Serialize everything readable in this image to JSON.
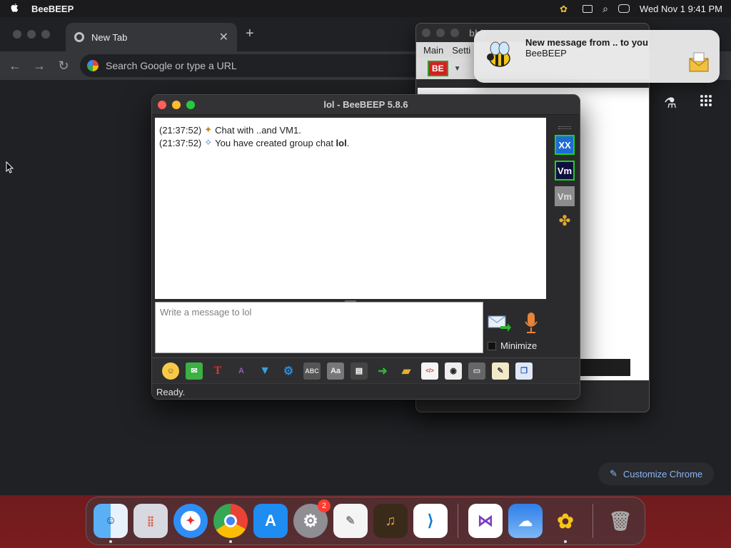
{
  "menubar": {
    "app_name": "BeeBEEP",
    "clock": "Wed Nov 1  9:41 PM"
  },
  "chrome": {
    "tab_title": "New Tab",
    "omnibox_placeholder": "Search Google or type a URL",
    "customize_label": "Customize Chrome"
  },
  "bg_window": {
    "title": "bbb",
    "menu": [
      "Main",
      "Setti"
    ]
  },
  "notification": {
    "title": "New message from .. to you",
    "subtitle": "BeeBEEP"
  },
  "chat_window": {
    "title": "lol - BeeBEEP 5.8.6",
    "messages": [
      {
        "time": "(21:37:52)",
        "text": "Chat with ..and VM1."
      },
      {
        "time": "(21:37:52)",
        "text": "You have created group chat ",
        "bold": "lol",
        "end": "."
      }
    ],
    "input_placeholder": "Write a message to lol",
    "minimize_label": "Minimize",
    "status": "Ready.",
    "users": [
      "XX",
      "Vm",
      "Vm"
    ]
  },
  "dock": {
    "settings_badge": "2"
  },
  "colors": {
    "accent_blue": "#8ab4f8",
    "close_red": "#ff5f57",
    "min_yellow": "#febc2e",
    "max_green": "#28c840"
  }
}
